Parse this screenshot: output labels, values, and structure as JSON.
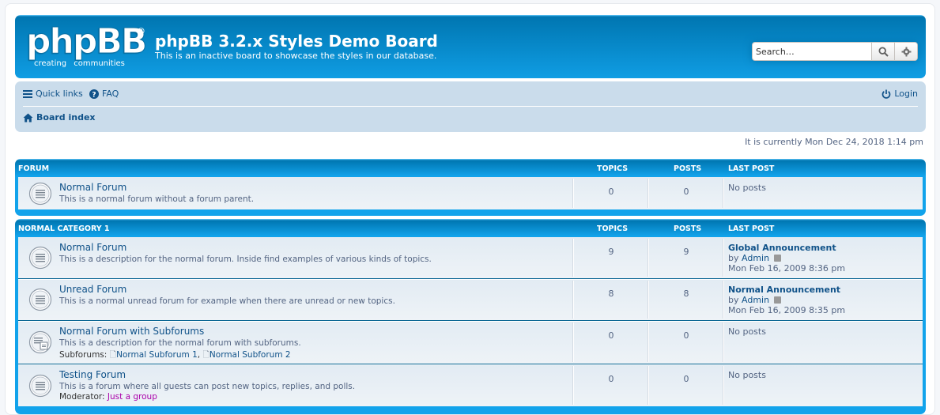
{
  "header": {
    "logo_text": "phpBB",
    "logo_sub": [
      "creating",
      "communities"
    ],
    "title": "phpBB 3.2.x Styles Demo Board",
    "description": "This is an inactive board to showcase the styles in our database.",
    "search_placeholder": "Search…",
    "search_icon": "search-icon",
    "advanced_icon": "gear-icon"
  },
  "navbar": {
    "quick_links": "Quick links",
    "faq": "FAQ",
    "login": "Login",
    "breadcrumb": "Board index"
  },
  "timeline": "It is currently Mon Dec 24, 2018 1:14 pm",
  "categories": [
    {
      "name": "FORUM",
      "col_topics": "TOPICS",
      "col_posts": "POSTS",
      "col_lastpost": "LAST POST",
      "forums": [
        {
          "title": "Normal Forum",
          "description": "This is a normal forum without a forum parent.",
          "topics": "0",
          "posts": "0",
          "last_post": "No posts"
        }
      ]
    },
    {
      "name": "NORMAL CATEGORY 1",
      "col_topics": "TOPICS",
      "col_posts": "POSTS",
      "col_lastpost": "LAST POST",
      "forums": [
        {
          "title": "Normal Forum",
          "description": "This is a description for the normal forum. Inside find examples of various kinds of topics.",
          "topics": "9",
          "posts": "9",
          "last_post_title": "Global Announcement",
          "last_post_by_label": "by",
          "last_post_by": "Admin",
          "last_post_date": "Mon Feb 16, 2009 8:36 pm"
        },
        {
          "title": "Unread Forum",
          "description": "This is a normal unread forum for example when there are unread or new topics.",
          "topics": "8",
          "posts": "8",
          "last_post_title": "Normal Announcement",
          "last_post_by_label": "by",
          "last_post_by": "Admin",
          "last_post_date": "Mon Feb 16, 2009 8:35 pm"
        },
        {
          "title": "Normal Forum with Subforums",
          "description": "This is a description for the normal forum with subforums.",
          "subforums_label": "Subforums:",
          "subforums": [
            "Normal Subforum 1",
            "Normal Subforum 2"
          ],
          "topics": "0",
          "posts": "0",
          "last_post": "No posts"
        },
        {
          "title": "Testing Forum",
          "description": "This is a forum where all guests can post new topics, replies, and polls.",
          "moderator_label": "Moderator:",
          "moderator": "Just a group",
          "topics": "0",
          "posts": "0",
          "last_post": "No posts"
        }
      ]
    }
  ],
  "colors": {
    "header_blue": "#12a3eb",
    "navbar_bg": "#cadceb",
    "link": "#105289",
    "group_link": "#aa00aa"
  }
}
